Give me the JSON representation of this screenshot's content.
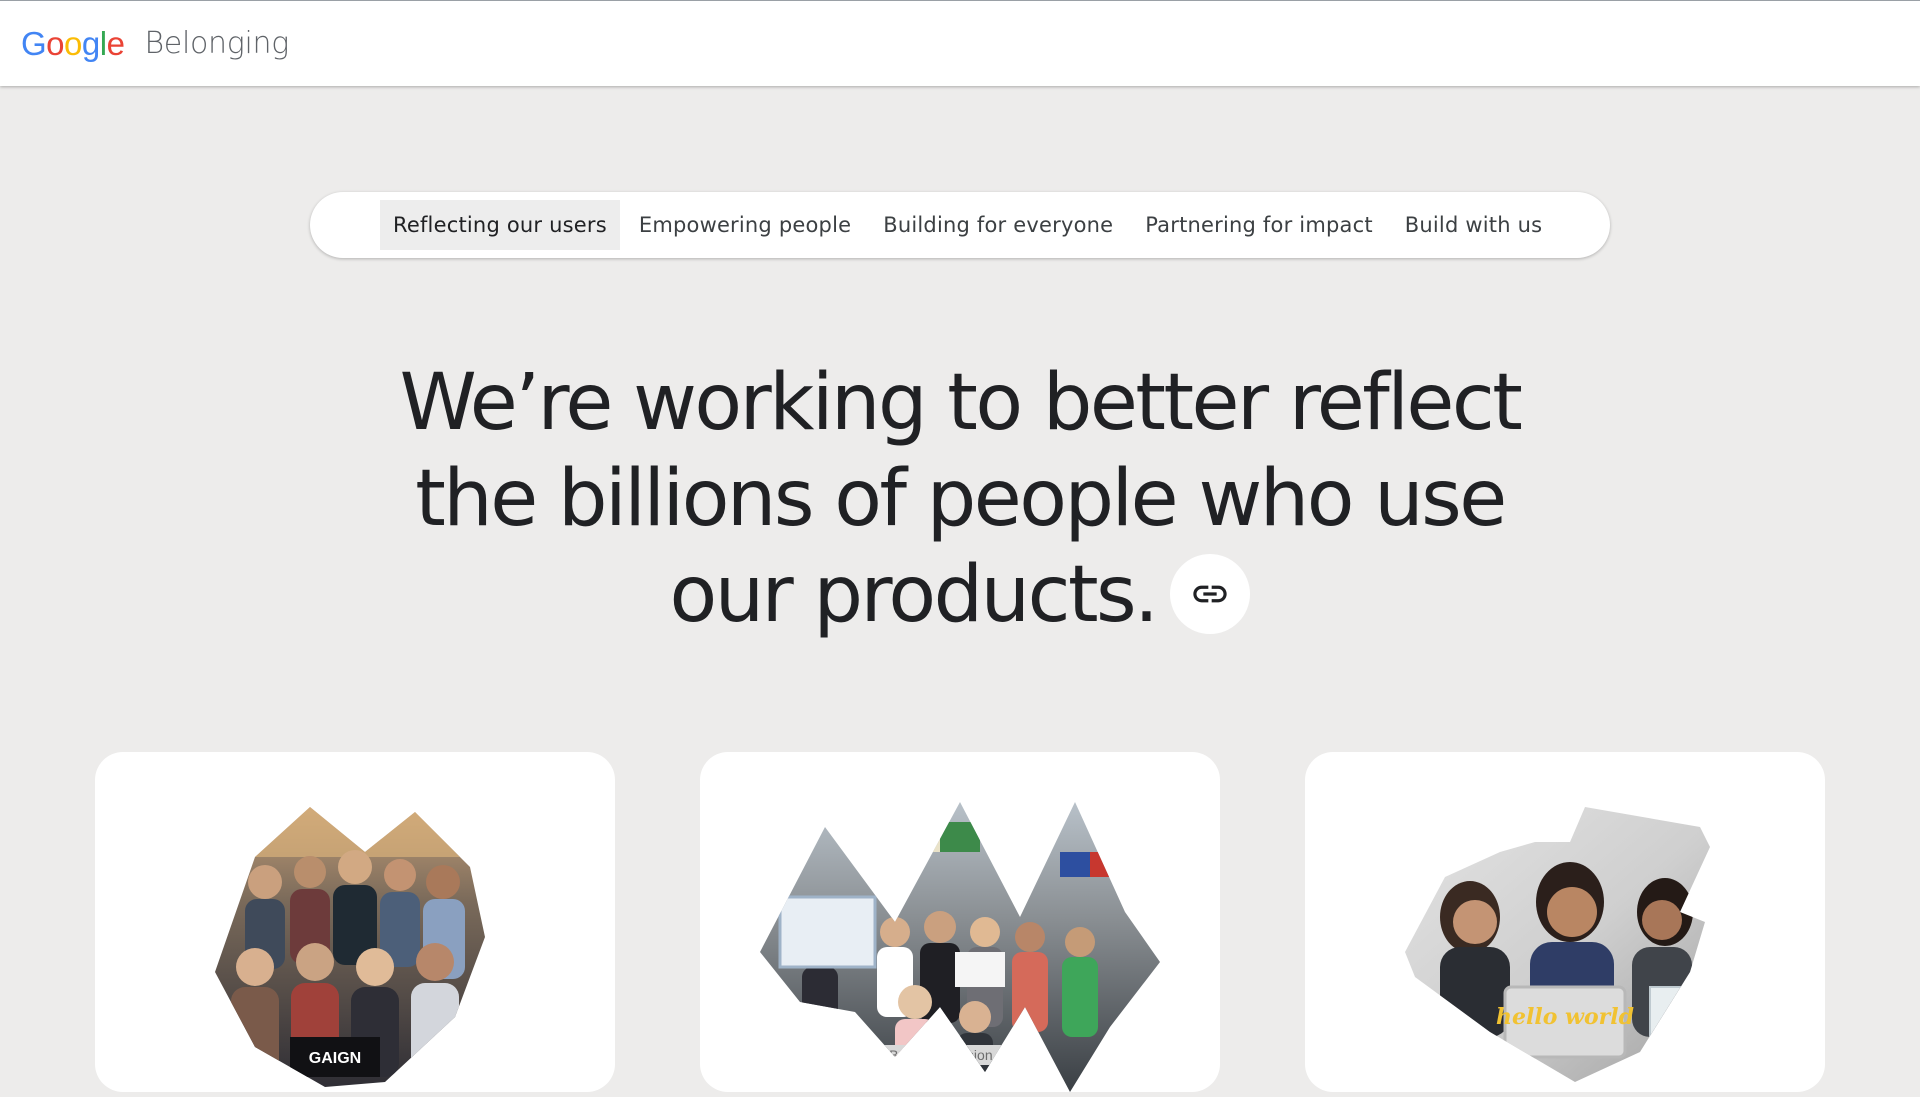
{
  "header": {
    "logo": {
      "letters": [
        "G",
        "o",
        "o",
        "g",
        "l",
        "e"
      ],
      "colors": [
        "#4285F4",
        "#EA4335",
        "#FBBC05",
        "#4285F4",
        "#34A853",
        "#EA4335"
      ]
    },
    "site_title": "Belonging"
  },
  "tabs": [
    {
      "label": "Reflecting our users",
      "active": true
    },
    {
      "label": "Empowering people",
      "active": false
    },
    {
      "label": "Building for everyone",
      "active": false
    },
    {
      "label": "Partnering for impact",
      "active": false
    },
    {
      "label": "Build with us",
      "active": false
    }
  ],
  "hero": {
    "lines": [
      "We’re working to better reflect",
      "the billions of people who use",
      "our products."
    ],
    "link_icon": "link-icon"
  },
  "cards": [
    {
      "image": "team-photo-shield-collage",
      "photo_text": "GAIGN"
    },
    {
      "image": "team-photo-zigzag-collage",
      "photo_text": "#BOLDImmersion"
    },
    {
      "image": "team-photo-bolt-collage",
      "photo_text": "hello world"
    }
  ],
  "colors": {
    "page_bg": "#edeceb",
    "card_bg": "#ffffff",
    "active_tab_bg": "#ededed"
  }
}
